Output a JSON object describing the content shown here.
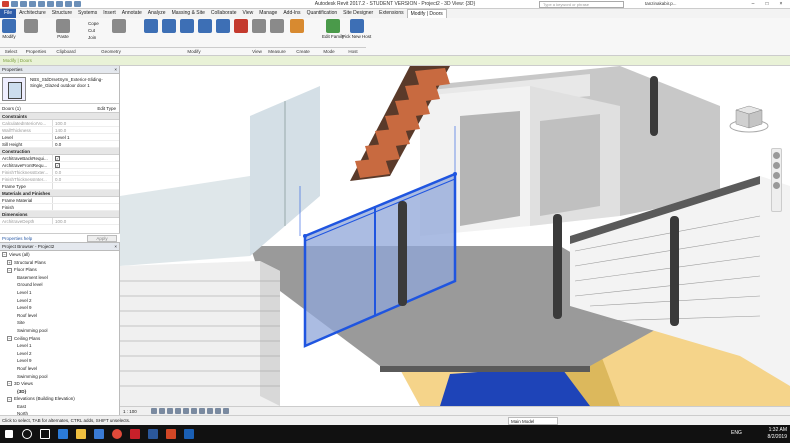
{
  "title": "Autodesk Revit 2017.2 - STUDENT VERSION -    Project2 - 3D View: {3D}",
  "search_placeholder": "Type a keyword or phrase",
  "user": "tanzinakabir.p...",
  "window_controls": [
    "–",
    "□",
    "×"
  ],
  "tabs": [
    {
      "label": "Architecture"
    },
    {
      "label": "Structure"
    },
    {
      "label": "Systems"
    },
    {
      "label": "Insert"
    },
    {
      "label": "Annotate"
    },
    {
      "label": "Analyze"
    },
    {
      "label": "Massing & Site"
    },
    {
      "label": "Collaborate"
    },
    {
      "label": "View"
    },
    {
      "label": "Manage"
    },
    {
      "label": "Add-Ins"
    },
    {
      "label": "Quantification"
    },
    {
      "label": "Site Designer"
    },
    {
      "label": "Extensions"
    },
    {
      "label": "Modify | Doors"
    }
  ],
  "file_tab": "File",
  "ribbon": {
    "modify": "Modify",
    "paste": "Paste",
    "clipboard_items": [
      "Cope",
      "Cut",
      "Join"
    ],
    "edit_family": "Edit Family",
    "pick_new_host": "Pick New Host",
    "groups": [
      "Select",
      "Properties",
      "Clipboard",
      "Geometry",
      "Modify",
      "View",
      "Measure",
      "Create",
      "Mode",
      "Host"
    ]
  },
  "options_bar": "Modify | Doors",
  "properties": {
    "header": "Properties",
    "close": "×",
    "type_name": "NBS_StdDrsetSym_Exterior-Sliding-Single_Glazed outdoor door 1",
    "instance": "Doors (1)",
    "edit_type": "Edit Type",
    "sections": [
      {
        "title": "Constraints",
        "rows": [
          {
            "k": "CalculatedInteriorVo...",
            "v": "100.0",
            "grey": true
          },
          {
            "k": "WallThickness",
            "v": "140.0",
            "grey": true
          },
          {
            "k": "Level",
            "v": "Level 1"
          },
          {
            "k": "Sill Height",
            "v": "0.0"
          }
        ]
      },
      {
        "title": "Construction",
        "rows": [
          {
            "k": "ArchitraveBackRequi...",
            "v": "✓",
            "cb": true
          },
          {
            "k": "ArchitraveFrontRequ...",
            "v": "✓",
            "cb": true
          },
          {
            "k": "FinishThicknessExter...",
            "v": "0.0",
            "grey": true
          },
          {
            "k": "FinishThicknessInter...",
            "v": "0.0",
            "grey": true
          },
          {
            "k": "Frame Type",
            "v": ""
          }
        ]
      },
      {
        "title": "Materials and Finishes",
        "rows": [
          {
            "k": "Frame Material",
            "v": ""
          },
          {
            "k": "Finish",
            "v": ""
          }
        ]
      },
      {
        "title": "Dimensions",
        "rows": [
          {
            "k": "ArchitraveDepth",
            "v": "100.0",
            "grey": true
          }
        ]
      }
    ],
    "help": "Properties help",
    "apply": "Apply"
  },
  "browser": {
    "header": "Project Browser - Project2",
    "close": "×",
    "items": [
      {
        "label": "Views (all)",
        "d": 0,
        "exp": "−",
        "bold": false
      },
      {
        "label": "Structural Plans",
        "d": 1,
        "exp": "+"
      },
      {
        "label": "Floor Plans",
        "d": 1,
        "exp": "−"
      },
      {
        "label": "Basement level",
        "d": 3
      },
      {
        "label": "Ground level",
        "d": 3
      },
      {
        "label": "Level 1",
        "d": 3
      },
      {
        "label": "Level 2",
        "d": 3
      },
      {
        "label": "Level 9",
        "d": 3
      },
      {
        "label": "Roof level",
        "d": 3
      },
      {
        "label": "Site",
        "d": 3
      },
      {
        "label": "Swimming pool",
        "d": 3
      },
      {
        "label": "Ceiling Plans",
        "d": 1,
        "exp": "−"
      },
      {
        "label": "Level 1",
        "d": 3
      },
      {
        "label": "Level 2",
        "d": 3
      },
      {
        "label": "Level 9",
        "d": 3
      },
      {
        "label": "Roof level",
        "d": 3
      },
      {
        "label": "Swimming pool",
        "d": 3
      },
      {
        "label": "3D Views",
        "d": 1,
        "exp": "−"
      },
      {
        "label": "{3D}",
        "d": 3,
        "bold": true
      },
      {
        "label": "Elevations (Building Elevation)",
        "d": 1,
        "exp": "−"
      },
      {
        "label": "East",
        "d": 3
      },
      {
        "label": "North",
        "d": 3
      }
    ]
  },
  "viewcube": {
    "front": "FRONT",
    "right": "RIGHT"
  },
  "view_scale": "1 : 100",
  "status": "Click to select, TAB for alternates, CTRL adds, SHIFT unselects.",
  "model": "Main Model",
  "clock": {
    "time": "1:32 AM",
    "date": "8/2/2019",
    "lang": "ENG"
  }
}
